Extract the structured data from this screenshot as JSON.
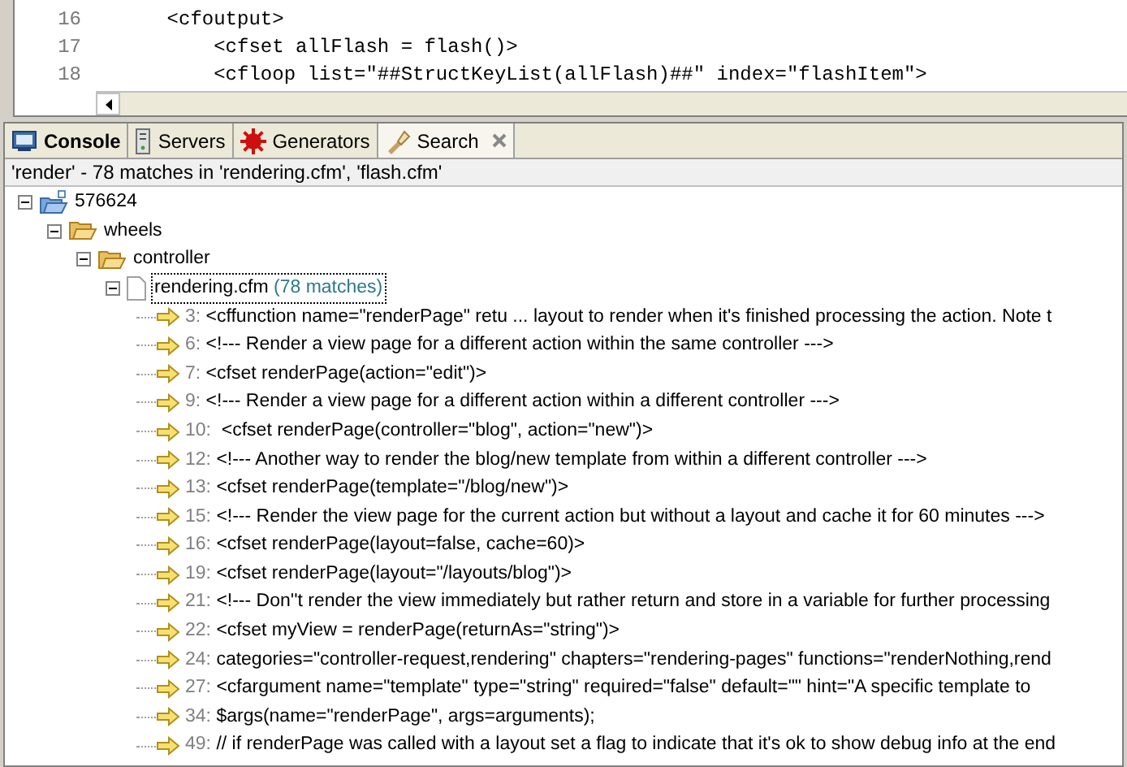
{
  "editor": {
    "lines": [
      {
        "number": "16",
        "code": "    <cfoutput>"
      },
      {
        "number": "17",
        "code": "        <cfset allFlash = flash()>"
      },
      {
        "number": "18",
        "code": "        <cfloop list=\"##StructKeyList(allFlash)##\" index=\"flashItem\">"
      }
    ]
  },
  "tabs": [
    {
      "label": "Console",
      "kind": "console",
      "selected": false,
      "bold": true,
      "closable": false
    },
    {
      "label": "Servers",
      "kind": "servers",
      "selected": false,
      "bold": false,
      "closable": false
    },
    {
      "label": "Generators",
      "kind": "generators",
      "selected": false,
      "bold": false,
      "closable": false
    },
    {
      "label": "Search",
      "kind": "search",
      "selected": true,
      "bold": false,
      "closable": true
    }
  ],
  "status": "'render' - 78 matches in 'rendering.cfm', 'flash.cfm'",
  "tree": [
    {
      "label": "576624",
      "kind": "project",
      "expanded": true,
      "children": [
        {
          "label": "wheels",
          "kind": "folder",
          "expanded": true,
          "children": [
            {
              "label": "controller",
              "kind": "folder",
              "expanded": true,
              "children": [
                {
                  "label": "rendering.cfm",
                  "count": "(78 matches)",
                  "kind": "file",
                  "expanded": true,
                  "selected": true,
                  "children": [
                    {
                      "kind": "match",
                      "line": "3:",
                      "label": "<cffunction name=\"renderPage\" retu ... layout to render when it's finished processing the action. Note t"
                    },
                    {
                      "kind": "match",
                      "line": "6:",
                      "label": "<!--- Render a view page for a different action within the same controller --->"
                    },
                    {
                      "kind": "match",
                      "line": "7:",
                      "label": "<cfset renderPage(action=\"edit\")>"
                    },
                    {
                      "kind": "match",
                      "line": "9:",
                      "label": "<!--- Render a view page for a different action within a different controller --->"
                    },
                    {
                      "kind": "match",
                      "line": "10:",
                      "label": " <cfset renderPage(controller=\"blog\", action=\"new\")>"
                    },
                    {
                      "kind": "match",
                      "line": "12:",
                      "label": "<!--- Another way to render the blog/new template from within a different controller --->"
                    },
                    {
                      "kind": "match",
                      "line": "13:",
                      "label": "<cfset renderPage(template=\"/blog/new\")>"
                    },
                    {
                      "kind": "match",
                      "line": "15:",
                      "label": "<!--- Render the view page for the current action but without a layout and cache it for 60 minutes --->"
                    },
                    {
                      "kind": "match",
                      "line": "16:",
                      "label": "<cfset renderPage(layout=false, cache=60)>"
                    },
                    {
                      "kind": "match",
                      "line": "19:",
                      "label": "<cfset renderPage(layout=\"/layouts/blog\")>"
                    },
                    {
                      "kind": "match",
                      "line": "21:",
                      "label": "<!--- Don''t render the view immediately but rather return and store in a variable for further processing"
                    },
                    {
                      "kind": "match",
                      "line": "22:",
                      "label": "<cfset myView = renderPage(returnAs=\"string\")>"
                    },
                    {
                      "kind": "match",
                      "line": "24:",
                      "label": "categories=\"controller-request,rendering\" chapters=\"rendering-pages\" functions=\"renderNothing,rend"
                    },
                    {
                      "kind": "match",
                      "line": "27:",
                      "label": "<cfargument name=\"template\" type=\"string\" required=\"false\" default=\"\" hint=\"A specific template to"
                    },
                    {
                      "kind": "match",
                      "line": "34:",
                      "label": "$args(name=\"renderPage\", args=arguments);"
                    },
                    {
                      "kind": "match",
                      "line": "49:",
                      "label": "// if renderPage was called with a layout set a flag to indicate that it's ok to show debug info at the end"
                    }
                  ]
                }
              ]
            }
          ]
        }
      ]
    }
  ]
}
